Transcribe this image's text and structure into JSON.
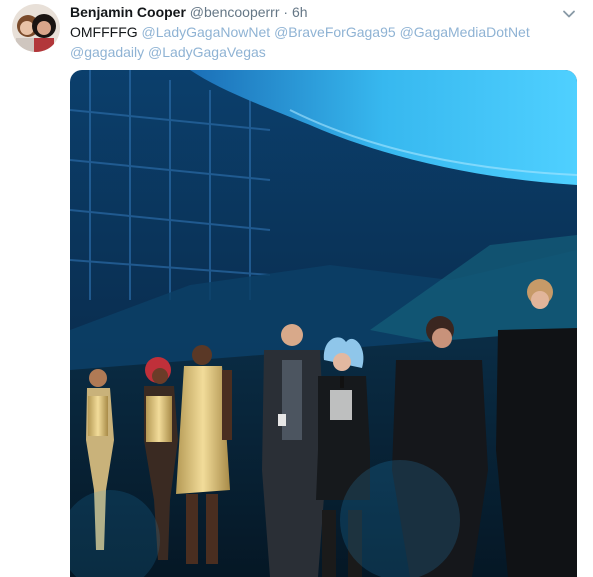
{
  "tweet": {
    "display_name": "Benjamin Cooper",
    "handle": "@bencooperrr",
    "separator": "·",
    "time": "6h",
    "text_prefix": "OMFFFFG",
    "mentions": [
      "@LadyGagaNowNet",
      "@BraveForGaga95",
      "@GagaMediaDotNet",
      "@gagadaily",
      "@LadyGagaVegas"
    ]
  },
  "icons": {
    "menu": "chevron-down-icon"
  },
  "colors": {
    "link": "#8fb3d4",
    "name": "#14171a",
    "muted": "#657786"
  }
}
